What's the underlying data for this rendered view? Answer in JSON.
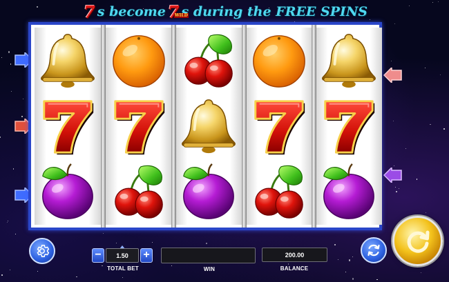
{
  "banner": {
    "seven_1": "7",
    "part_1": "s become",
    "seven_2": "7",
    "wild_tag": "WILD",
    "part_2": "s during the FREE SPINS"
  },
  "reels": [
    [
      "bell",
      "seven",
      "plum"
    ],
    [
      "orange",
      "seven",
      "cherry"
    ],
    [
      "cherry",
      "bell",
      "plum"
    ],
    [
      "orange",
      "seven",
      "cherry"
    ],
    [
      "bell",
      "seven",
      "plum"
    ]
  ],
  "controls": {
    "settings_icon": "gear-icon",
    "bet_minus": "−",
    "bet_plus": "+",
    "bet_value": "1.50",
    "total_bet_label": "TOTAL BET",
    "win_value": "",
    "win_label": "WIN",
    "balance_value": "200.00",
    "balance_label": "BALANCE",
    "autoplay_icon": "autoplay-icon",
    "spin_icon": "spin-icon"
  },
  "colors": {
    "frame": "#2a46c9",
    "banner_text": "#4fd8ef",
    "seven_red": "#e21b1b",
    "spin_gold": "#f3c21c",
    "button_blue": "#2b5fe0"
  }
}
